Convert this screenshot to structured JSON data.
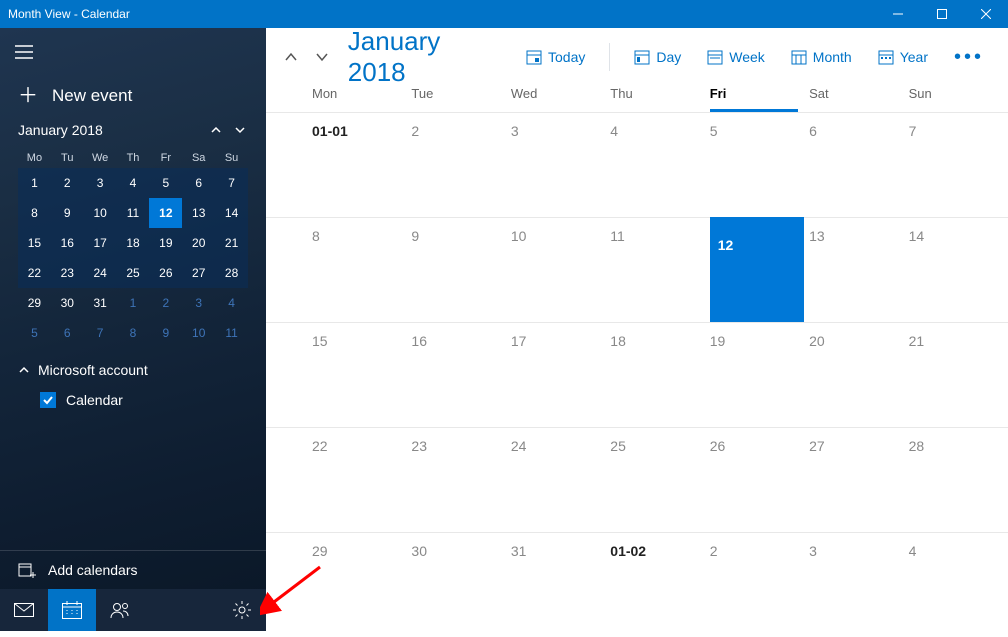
{
  "window": {
    "title": "Month View - Calendar"
  },
  "sidebar": {
    "newEvent": "New event",
    "minical": {
      "title": "January 2018",
      "dow": [
        "Mo",
        "Tu",
        "We",
        "Th",
        "Fr",
        "Sa",
        "Su"
      ],
      "weeks": [
        {
          "days": [
            "1",
            "2",
            "3",
            "4",
            "5",
            "6",
            "7"
          ],
          "styles": [
            "",
            "",
            "",
            "",
            "",
            "",
            ""
          ],
          "rowStyle": "current"
        },
        {
          "days": [
            "8",
            "9",
            "10",
            "11",
            "12",
            "13",
            "14"
          ],
          "styles": [
            "",
            "",
            "",
            "",
            "today",
            "",
            ""
          ],
          "rowStyle": "current"
        },
        {
          "days": [
            "15",
            "16",
            "17",
            "18",
            "19",
            "20",
            "21"
          ],
          "styles": [
            "",
            "",
            "",
            "",
            "",
            "",
            ""
          ],
          "rowStyle": "current"
        },
        {
          "days": [
            "22",
            "23",
            "24",
            "25",
            "26",
            "27",
            "28"
          ],
          "styles": [
            "",
            "",
            "",
            "",
            "",
            "",
            ""
          ],
          "rowStyle": "current"
        },
        {
          "days": [
            "29",
            "30",
            "31",
            "1",
            "2",
            "3",
            "4"
          ],
          "styles": [
            "",
            "",
            "",
            "othermonth",
            "othermonth",
            "othermonth",
            "othermonth"
          ],
          "rowStyle": ""
        },
        {
          "days": [
            "5",
            "6",
            "7",
            "8",
            "9",
            "10",
            "11"
          ],
          "styles": [
            "faded",
            "faded",
            "faded",
            "faded",
            "faded",
            "faded",
            "faded"
          ],
          "rowStyle": ""
        }
      ]
    },
    "account": {
      "title": "Microsoft account",
      "items": [
        {
          "label": "Calendar",
          "checked": true
        }
      ]
    },
    "addCalendars": "Add calendars"
  },
  "header": {
    "month": "January 2018",
    "today": "Today",
    "views": {
      "day": "Day",
      "week": "Week",
      "month": "Month",
      "year": "Year"
    }
  },
  "grid": {
    "dow": [
      "Mon",
      "Tue",
      "Wed",
      "Thu",
      "Fri",
      "Sat",
      "Sun"
    ],
    "todayCol": 4,
    "weeks": [
      {
        "cells": [
          "01-01",
          "2",
          "3",
          "4",
          "5",
          "6",
          "7"
        ],
        "boldIdx": 0
      },
      {
        "cells": [
          "8",
          "9",
          "10",
          "11",
          "12",
          "13",
          "14"
        ],
        "todayIdx": 4
      },
      {
        "cells": [
          "15",
          "16",
          "17",
          "18",
          "19",
          "20",
          "21"
        ]
      },
      {
        "cells": [
          "22",
          "23",
          "24",
          "25",
          "26",
          "27",
          "28"
        ]
      },
      {
        "cells": [
          "29",
          "30",
          "31",
          "01-02",
          "2",
          "3",
          "4"
        ],
        "boldIdx": 3
      }
    ]
  }
}
